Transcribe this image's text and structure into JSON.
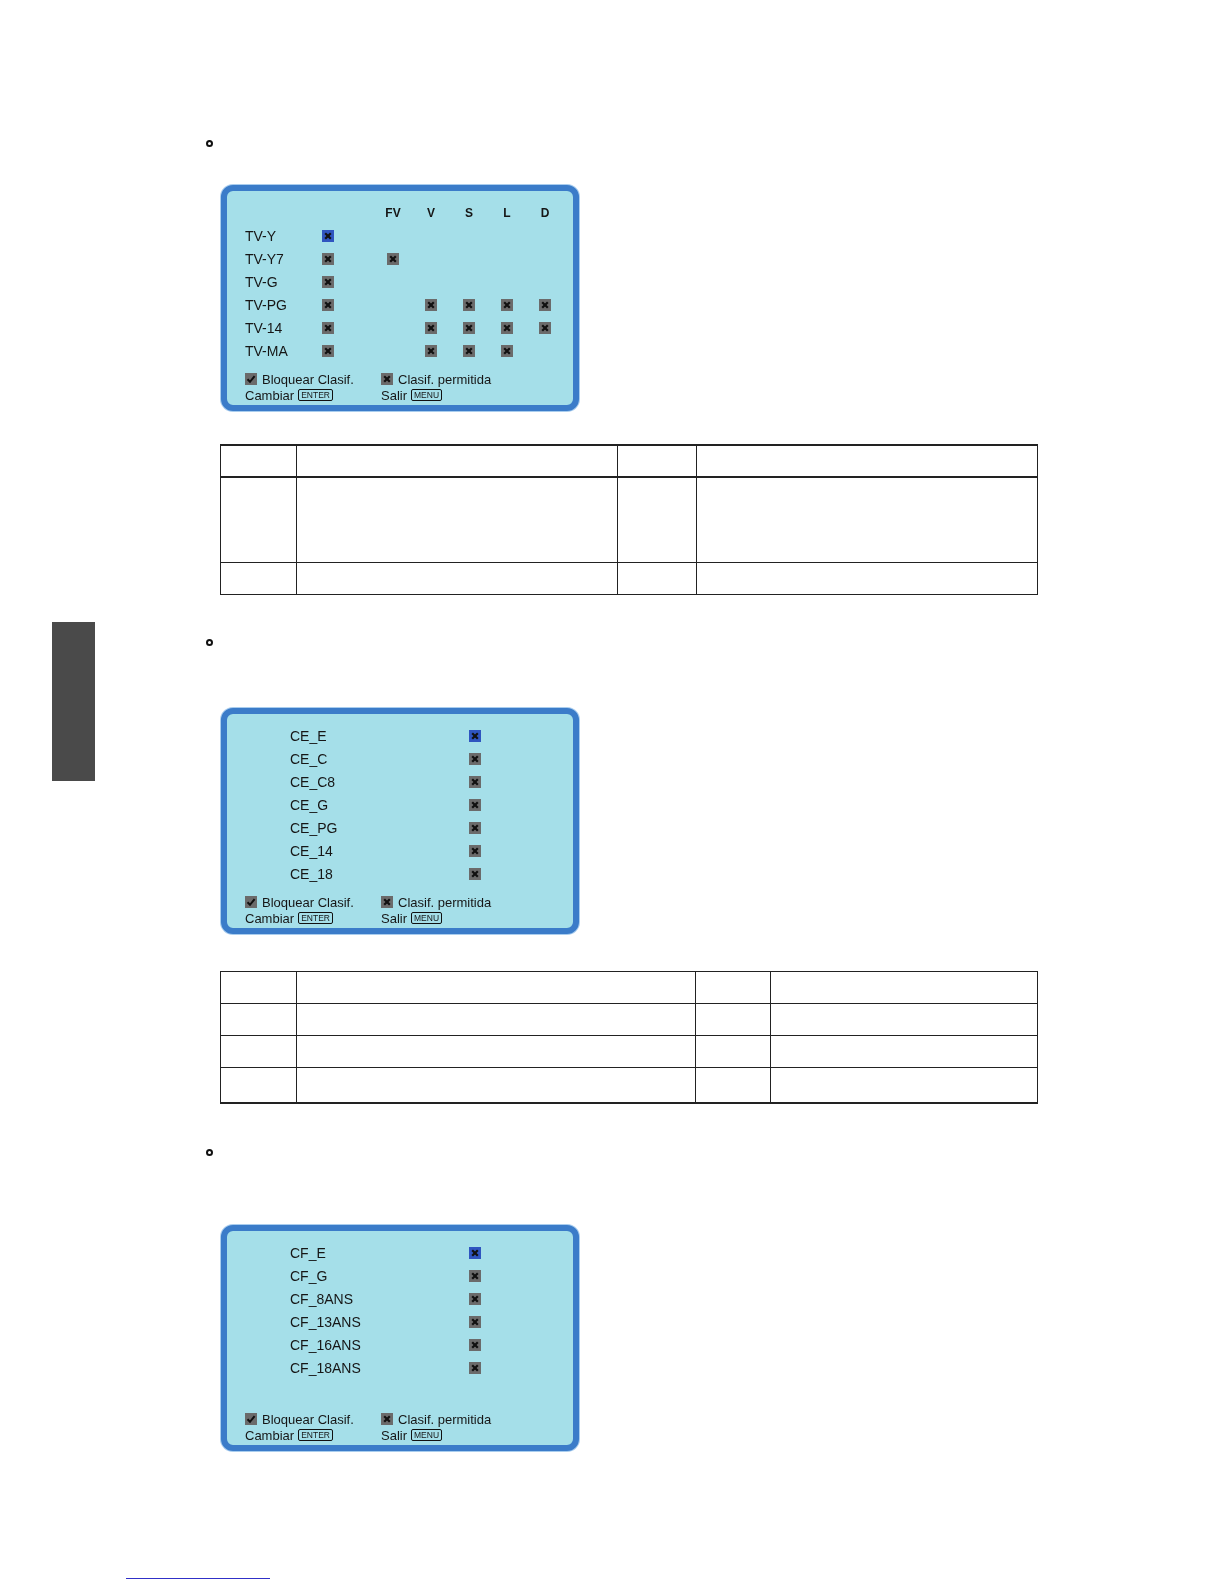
{
  "sections": [
    {
      "menu": {
        "kind": "matrix",
        "columns": [
          "FV",
          "V",
          "S",
          "L",
          "D"
        ],
        "rows": [
          {
            "label": "TV-Y",
            "selected": true,
            "boxes": [
              true,
              false,
              false,
              false,
              false,
              false
            ]
          },
          {
            "label": "TV-Y7",
            "selected": false,
            "boxes": [
              true,
              true,
              false,
              false,
              false,
              false
            ]
          },
          {
            "label": "TV-G",
            "selected": false,
            "boxes": [
              true,
              false,
              false,
              false,
              false,
              false
            ]
          },
          {
            "label": "TV-PG",
            "selected": false,
            "boxes": [
              true,
              false,
              true,
              true,
              true,
              true
            ]
          },
          {
            "label": "TV-14",
            "selected": false,
            "boxes": [
              true,
              false,
              true,
              true,
              true,
              true
            ]
          },
          {
            "label": "TV-MA",
            "selected": false,
            "boxes": [
              true,
              false,
              true,
              true,
              true,
              false
            ]
          }
        ],
        "legend": [
          {
            "kind": "check",
            "label": "Bloquear Clasif."
          },
          {
            "kind": "cross",
            "label": "Clasif. permitida"
          }
        ],
        "hints": [
          {
            "label": "Cambiar",
            "key": "ENTER"
          },
          {
            "label": "Salir",
            "key": "MENU"
          }
        ]
      },
      "table": {
        "kind": "tall"
      }
    },
    {
      "menu": {
        "kind": "list",
        "rows": [
          {
            "label": "CE_E",
            "selected": true,
            "boxes": [
              true
            ]
          },
          {
            "label": "CE_C",
            "selected": false,
            "boxes": [
              true
            ]
          },
          {
            "label": "CE_C8",
            "selected": false,
            "boxes": [
              true
            ]
          },
          {
            "label": "CE_G",
            "selected": false,
            "boxes": [
              true
            ]
          },
          {
            "label": "CE_PG",
            "selected": false,
            "boxes": [
              true
            ]
          },
          {
            "label": "CE_14",
            "selected": false,
            "boxes": [
              true
            ]
          },
          {
            "label": "CE_18",
            "selected": false,
            "boxes": [
              true
            ]
          }
        ],
        "legend": [
          {
            "kind": "check",
            "label": "Bloquear Clasif."
          },
          {
            "kind": "cross",
            "label": "Clasif. permitida"
          }
        ],
        "hints": [
          {
            "label": "Cambiar",
            "key": "ENTER"
          },
          {
            "label": "Salir",
            "key": "MENU"
          }
        ]
      },
      "table": {
        "kind": "even"
      }
    },
    {
      "menu": {
        "kind": "list",
        "rows": [
          {
            "label": "CF_E",
            "selected": true,
            "boxes": [
              true
            ]
          },
          {
            "label": "CF_G",
            "selected": false,
            "boxes": [
              true
            ]
          },
          {
            "label": "CF_8ANS",
            "selected": false,
            "boxes": [
              true
            ]
          },
          {
            "label": "CF_13ANS",
            "selected": false,
            "boxes": [
              true
            ]
          },
          {
            "label": "CF_16ANS",
            "selected": false,
            "boxes": [
              true
            ]
          },
          {
            "label": "CF_18ANS",
            "selected": false,
            "boxes": [
              true
            ]
          }
        ],
        "legend": [
          {
            "kind": "check",
            "label": "Bloquear Clasif."
          },
          {
            "kind": "cross",
            "label": "Clasif. permitida"
          }
        ],
        "hints": [
          {
            "label": "Cambiar",
            "key": "ENTER"
          },
          {
            "label": "Salir",
            "key": "MENU"
          }
        ]
      }
    }
  ]
}
